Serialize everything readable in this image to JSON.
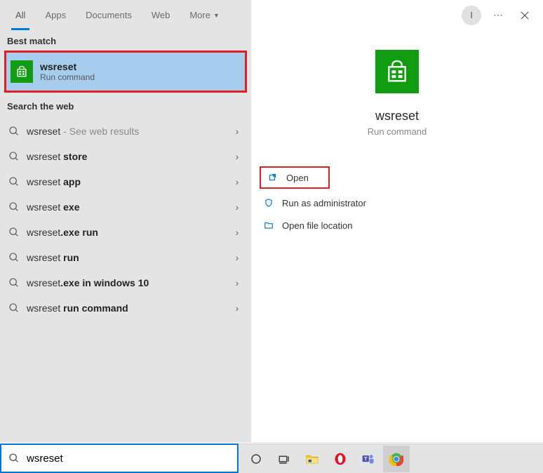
{
  "tabs": {
    "all": "All",
    "apps": "Apps",
    "documents": "Documents",
    "web": "Web",
    "more": "More"
  },
  "avatar_initial": "I",
  "best_match_header": "Best match",
  "best_match": {
    "title": "wsreset",
    "subtitle": "Run command"
  },
  "search_web_header": "Search the web",
  "web_results": [
    {
      "prefix": "wsreset",
      "suffix": "",
      "trail": " - See web results"
    },
    {
      "prefix": "wsreset ",
      "suffix": "store",
      "trail": ""
    },
    {
      "prefix": "wsreset ",
      "suffix": "app",
      "trail": ""
    },
    {
      "prefix": "wsreset ",
      "suffix": "exe",
      "trail": ""
    },
    {
      "prefix": "wsreset",
      "suffix": ".exe run",
      "trail": ""
    },
    {
      "prefix": "wsreset ",
      "suffix": "run",
      "trail": ""
    },
    {
      "prefix": "wsreset",
      "suffix": ".exe in windows 10",
      "trail": ""
    },
    {
      "prefix": "wsreset ",
      "suffix": "run command",
      "trail": ""
    }
  ],
  "detail": {
    "title": "wsreset",
    "subtitle": "Run command",
    "actions": {
      "open": "Open",
      "run_admin": "Run as administrator",
      "open_location": "Open file location"
    }
  },
  "search_input": "wsreset"
}
